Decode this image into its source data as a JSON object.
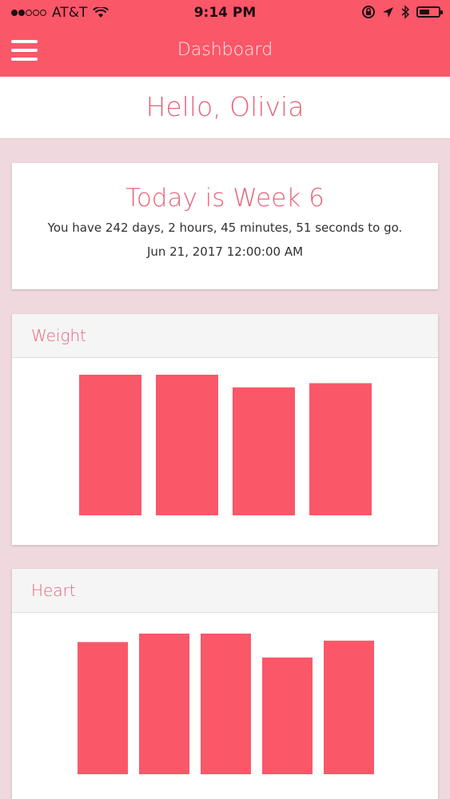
{
  "status_bar": {
    "carrier": "AT&T",
    "time": "9:14 PM",
    "signal_bars_filled": 2,
    "signal_bars_total": 5,
    "icons": [
      "wifi-icon",
      "lock-rotation-icon",
      "location-arrow-icon",
      "bluetooth-icon",
      "battery-icon"
    ]
  },
  "header": {
    "title": "Dashboard",
    "menu_icon": "hamburger-menu-icon"
  },
  "greeting": {
    "text": "Hello, Olivia"
  },
  "week_card": {
    "title": "Today is Week 6",
    "detail": "You have 242 days, 2 hours, 45 minutes, 51 seconds to go.",
    "date": "Jun 21, 2017 12:00:00 AM"
  },
  "charts": [
    {
      "title": "Weight",
      "chart_data": {
        "type": "bar",
        "categories": [
          "",
          "",
          "",
          ""
        ],
        "values": [
          100,
          100,
          91,
          94
        ],
        "ylim": [
          0,
          100
        ],
        "grid": false,
        "legend": "none"
      }
    },
    {
      "title": "Heart",
      "chart_data": {
        "type": "bar",
        "categories": [
          "",
          "",
          "",
          "",
          ""
        ],
        "values": [
          94,
          100,
          100,
          83,
          95
        ],
        "ylim": [
          0,
          100
        ],
        "grid": false,
        "legend": "none"
      }
    }
  ],
  "colors": {
    "brand": "#fa5769",
    "accent_text": "#e86278",
    "page_background": "#efd9de"
  }
}
